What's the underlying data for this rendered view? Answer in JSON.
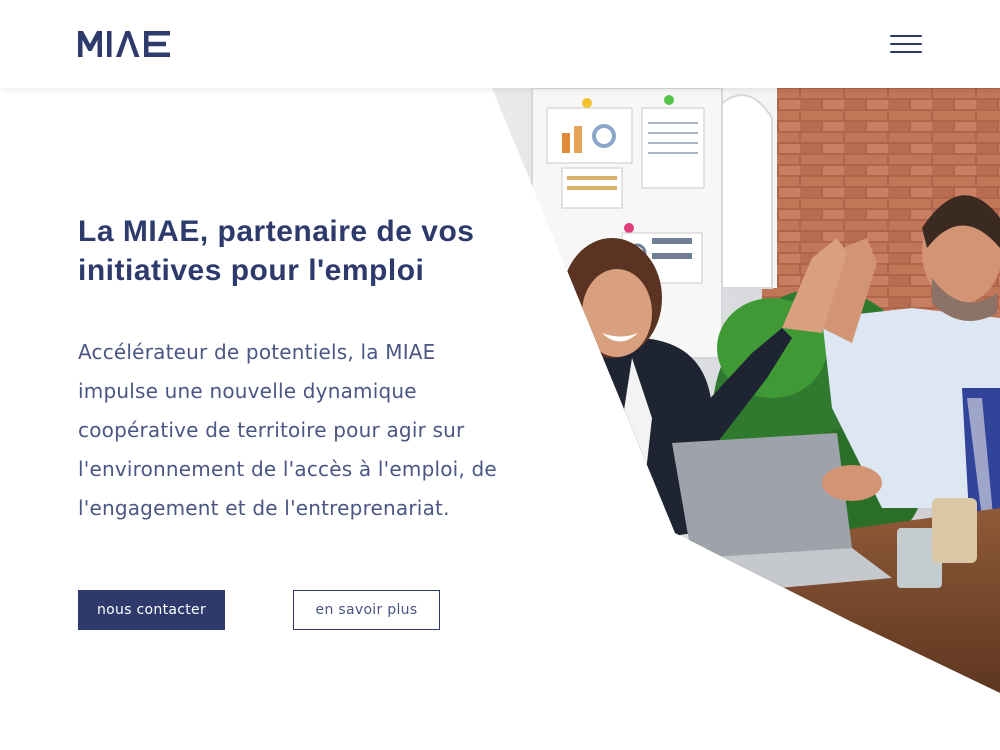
{
  "header": {
    "logo_text": "MIAE",
    "menu_icon": "hamburger-menu-icon"
  },
  "hero": {
    "title": "La MIAE, partenaire de vos initiatives pour l'emploi",
    "description": "Accélérateur de potentiels, la MIAE impulse une nouvelle dynamique coopérative de territoire pour agir sur l'environnement de l'accès à l'emploi, de l'engagement et de l'entreprenariat.",
    "image_icon": "office-high-five-photo"
  },
  "actions": {
    "contact_label": "nous contacter",
    "more_label": "en savoir plus"
  },
  "colors": {
    "brand": "#2d3a6b",
    "text": "#4a5683",
    "background": "#ffffff"
  }
}
